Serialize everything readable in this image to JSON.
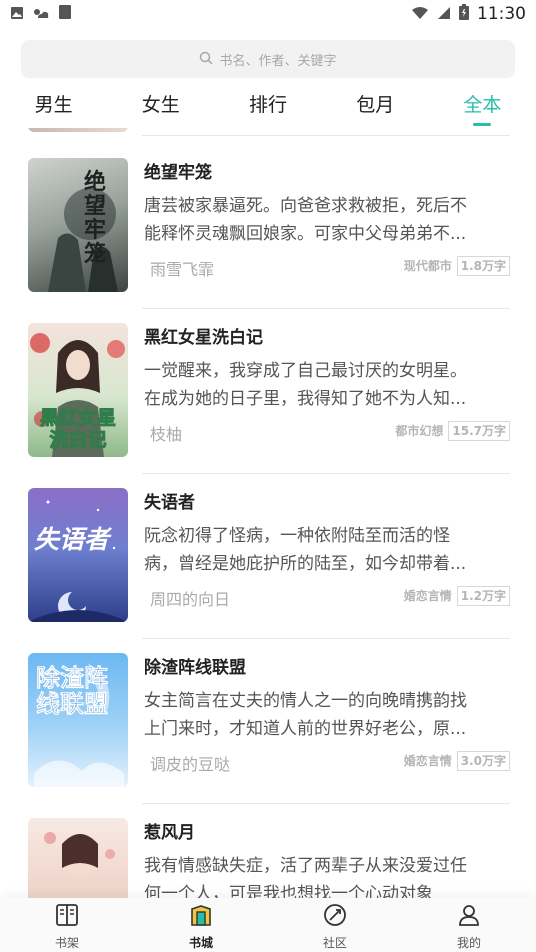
{
  "status_bar": {
    "time": "11:30",
    "left_icons": [
      "image-icon",
      "weather-icon",
      "app-icon"
    ],
    "right_icons": [
      "wifi-icon",
      "signal-icon",
      "battery-icon"
    ]
  },
  "search": {
    "placeholder": "书名、作者、关键字"
  },
  "tabs": [
    {
      "label": "男生",
      "active": false
    },
    {
      "label": "女生",
      "active": false
    },
    {
      "label": "排行",
      "active": false
    },
    {
      "label": "包月",
      "active": false
    },
    {
      "label": "全本",
      "active": true
    }
  ],
  "accent_color": "#27bfa8",
  "books": [
    {
      "title": "绝望牢笼",
      "desc_line1": "唐芸被家暴逼死。向爸爸求救被拒，死后不",
      "desc_line2": "能释怀灵魂飘回娘家。可家中父母弟弟不...",
      "author": "雨雪飞霏",
      "genre": "现代都市",
      "words": "1.8万字",
      "cover_text": "绝望牢笼"
    },
    {
      "title": "黑红女星洗白记",
      "desc_line1": "一觉醒来，我穿成了自己最讨厌的女明星。",
      "desc_line2": "在成为她的日子里，我得知了她不为人知...",
      "author": "枝柚",
      "genre": "都市幻想",
      "words": "15.7万字",
      "cover_text": "黑红女星洗白记"
    },
    {
      "title": "失语者",
      "desc_line1": "阮念初得了怪病，一种依附陆至而活的怪",
      "desc_line2": "病，曾经是她庇护所的陆至，如今却带着...",
      "author": "周四的向日",
      "genre": "婚恋言情",
      "words": "1.2万字",
      "cover_text": "失语者"
    },
    {
      "title": "除渣阵线联盟",
      "desc_line1": "女主简言在丈夫的情人之一的向晚晴携韵找",
      "desc_line2": "上门来时，才知道人前的世界好老公，原...",
      "author": "调皮的豆哒",
      "genre": "婚恋言情",
      "words": "3.0万字",
      "cover_text": "除渣阵线联盟"
    },
    {
      "title": "惹风月",
      "desc_line1": "我有情感缺失症，活了两辈子从来没爱过任",
      "desc_line2": "何一个人，可是我也想找一个心动对象",
      "author": "",
      "genre": "",
      "words": "",
      "cover_text": ""
    }
  ],
  "bottom_nav": [
    {
      "label": "书架",
      "icon": "bookshelf-icon",
      "active": false
    },
    {
      "label": "书城",
      "icon": "bookstore-icon",
      "active": true
    },
    {
      "label": "社区",
      "icon": "community-icon",
      "active": false
    },
    {
      "label": "我的",
      "icon": "profile-icon",
      "active": false
    }
  ]
}
